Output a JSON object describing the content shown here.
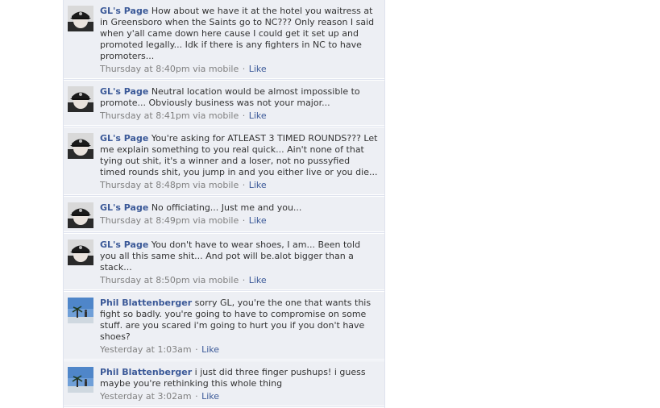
{
  "comments": [
    {
      "avatar": "gl-avatar",
      "author": "GL's Page",
      "text": "How about we have it at the hotel you waitress at in Greensboro when the Saints go to NC??? Only reason I said when y'all came down here cause I could get it set up and promoted legally... Idk if there is any fighters in NC to have promoters...",
      "time": "Thursday at 8:40pm",
      "via": "via mobile",
      "like": "Like"
    },
    {
      "avatar": "gl-avatar",
      "author": "GL's Page",
      "text": "Neutral location would be almost impossible to promote... Obviously business was not your major...",
      "time": "Thursday at 8:41pm",
      "via": "via mobile",
      "like": "Like"
    },
    {
      "avatar": "gl-avatar",
      "author": "GL's Page",
      "text": "You're asking for ATLEAST 3 TIMED ROUNDS??? Let me explain something to you real quick... Ain't none of that tying out shit, it's a winner and a loser, not no pussyfied timed rounds shit, you jump in and you either live or you die...",
      "time": "Thursday at 8:48pm",
      "via": "via mobile",
      "like": "Like"
    },
    {
      "avatar": "gl-avatar",
      "author": "GL's Page",
      "text": "No officiating... Just me and you...",
      "time": "Thursday at 8:49pm",
      "via": "via mobile",
      "like": "Like"
    },
    {
      "avatar": "gl-avatar",
      "author": "GL's Page",
      "text": "You don't have to wear shoes, I am... Been told you all this same shit... And pot will be.alot bigger than a stack...",
      "time": "Thursday at 8:50pm",
      "via": "via mobile",
      "like": "Like"
    },
    {
      "avatar": "phil-avatar",
      "author": "Phil Blattenberger",
      "text": "sorry GL, you're the one that wants this fight so badly. you're going to have to compromise on some stuff. are you scared i'm going to hurt you if you don't have shoes?",
      "time": "Yesterday at 1:03am",
      "via": "",
      "like": "Like"
    },
    {
      "avatar": "phil-avatar",
      "author": "Phil Blattenberger",
      "text": "i just did three finger pushups! i guess maybe you're rethinking this whole thing",
      "time": "Yesterday at 3:02am",
      "via": "",
      "like": "Like"
    }
  ]
}
